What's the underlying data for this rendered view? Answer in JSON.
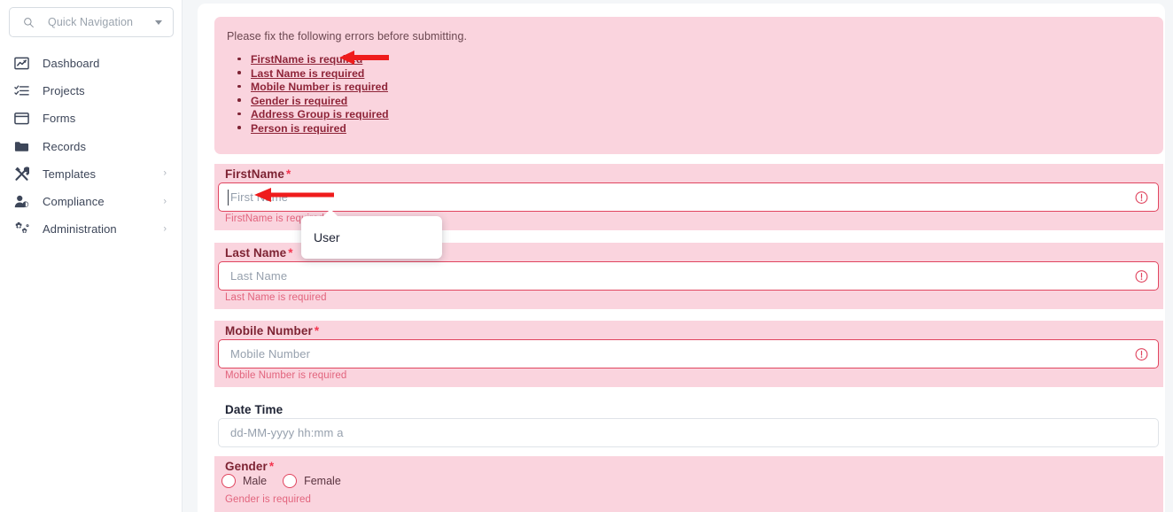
{
  "sidebar": {
    "quick_nav": {
      "placeholder": "Quick Navigation",
      "search_icon": "search-icon",
      "caret_icon": "chevron-down-icon"
    },
    "items": [
      {
        "label": "Dashboard",
        "icon": "chart-line-icon",
        "has_chevron": false,
        "chevron": ""
      },
      {
        "label": "Projects",
        "icon": "task-list-icon",
        "has_chevron": false,
        "chevron": ""
      },
      {
        "label": "Forms",
        "icon": "window-form-icon",
        "has_chevron": false,
        "chevron": ""
      },
      {
        "label": "Records",
        "icon": "folder-icon",
        "has_chevron": false,
        "chevron": ""
      },
      {
        "label": "Templates",
        "icon": "tools-icon",
        "has_chevron": true,
        "chevron": "›"
      },
      {
        "label": "Compliance",
        "icon": "user-shield-icon",
        "has_chevron": true,
        "chevron": "›"
      },
      {
        "label": "Administration",
        "icon": "cogs-icon",
        "has_chevron": true,
        "chevron": "›"
      }
    ]
  },
  "error_panel": {
    "intro": "Please fix the following errors before submitting.",
    "errors": [
      "FirstName is required",
      "Last Name is required",
      "Mobile Number is required",
      "Gender is required",
      "Address Group is required",
      "Person is required"
    ]
  },
  "form": {
    "fields": [
      {
        "key": "firstname",
        "label": "FirstName",
        "required_mark": "*",
        "required": true,
        "placeholder": "First Name",
        "value": "",
        "invalid": true,
        "message": "FirstName is required",
        "error_icon": "exclamation-circle-icon",
        "focused": true
      },
      {
        "key": "lastname",
        "label": "Last Name",
        "required_mark": "*",
        "required": true,
        "placeholder": "Last Name",
        "value": "",
        "invalid": true,
        "message": "Last Name is required",
        "error_icon": "exclamation-circle-icon",
        "focused": false
      },
      {
        "key": "mobile",
        "label": "Mobile Number",
        "required_mark": "*",
        "required": true,
        "placeholder": "Mobile Number",
        "value": "",
        "invalid": true,
        "message": "Mobile Number is required",
        "error_icon": "exclamation-circle-icon",
        "focused": false
      },
      {
        "key": "datetime",
        "label": "Date Time",
        "required_mark": "",
        "required": false,
        "placeholder": "dd-MM-yyyy hh:mm a",
        "value": "",
        "invalid": false,
        "message": "",
        "error_icon": "",
        "focused": false
      }
    ],
    "gender": {
      "label": "Gender",
      "required_mark": "*",
      "options": [
        {
          "label": "Male",
          "selected": false
        },
        {
          "label": "Female",
          "selected": false
        }
      ],
      "message": "Gender is required",
      "invalid": true
    }
  },
  "tooltip": {
    "text": "User"
  },
  "annotations": [
    {
      "name": "arrow-to-firstname-error-link",
      "color": "#ef1c1c"
    },
    {
      "name": "arrow-to-firstname-input",
      "color": "#ef1c1c"
    }
  ],
  "colors": {
    "invalid_bg": "#fad4de",
    "invalid_border": "#e0455f",
    "invalid_label": "#7d2333",
    "error_link": "#8e2438",
    "error_message": "#e2647d",
    "required_star": "#f4354f",
    "sidebar_text": "#3d4659",
    "page_bg": "#f4f6f8",
    "annotation_red": "#ef1c1c"
  }
}
